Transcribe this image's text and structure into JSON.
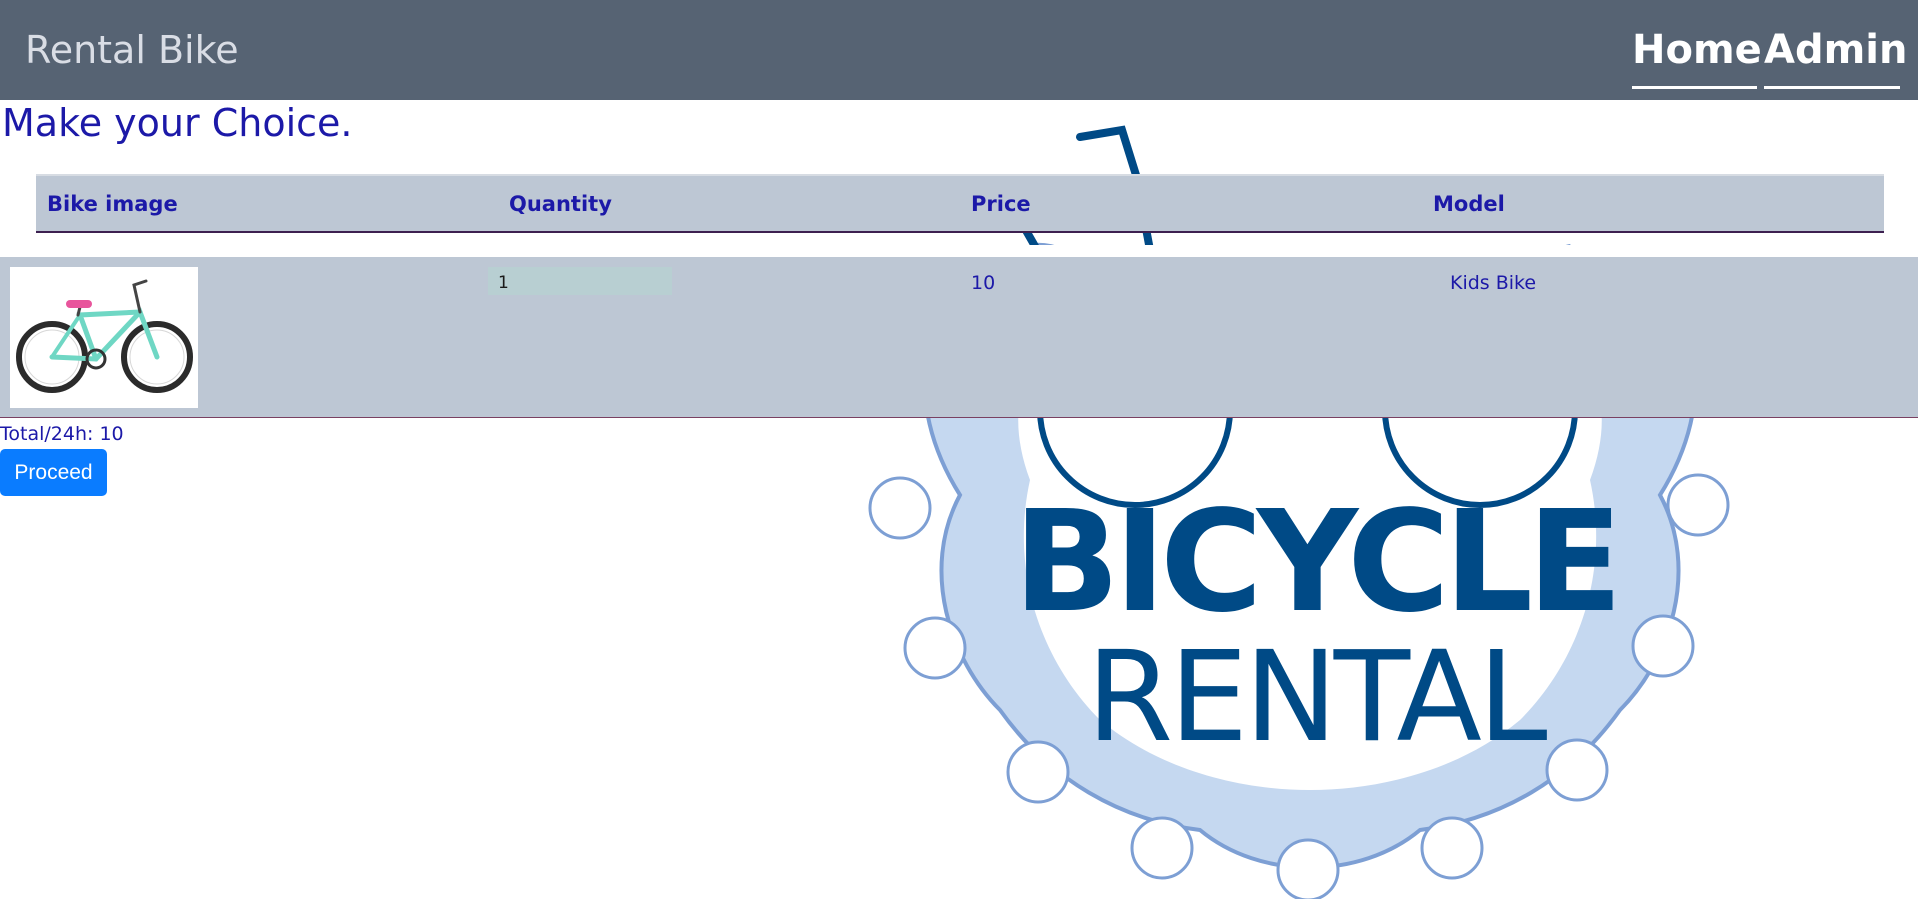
{
  "navbar": {
    "brand": "Rental Bike",
    "links": [
      "Home",
      "Admin"
    ]
  },
  "page": {
    "heading": "Make your Choice."
  },
  "table": {
    "columns": [
      "Bike image",
      "Quantity",
      "Price",
      "Model"
    ],
    "rows": [
      {
        "image_icon": "kids-bike-photo",
        "quantity": "1",
        "price": "10",
        "model": "Kids Bike"
      }
    ]
  },
  "summary": {
    "total_label": "Total/24h:",
    "total_value": "10"
  },
  "actions": {
    "proceed_label": "Proceed"
  },
  "background_logo": {
    "line1": "BICYCLE",
    "line2": "RENTAL"
  },
  "colors": {
    "navbar": "#566373",
    "accent_text": "#1c19a8",
    "table_bg": "#bdc7d4",
    "button": "#0a7cff",
    "logo_dark": "#004a86",
    "logo_light": "#c5d8f0",
    "logo_mid": "#7d9fd4"
  }
}
